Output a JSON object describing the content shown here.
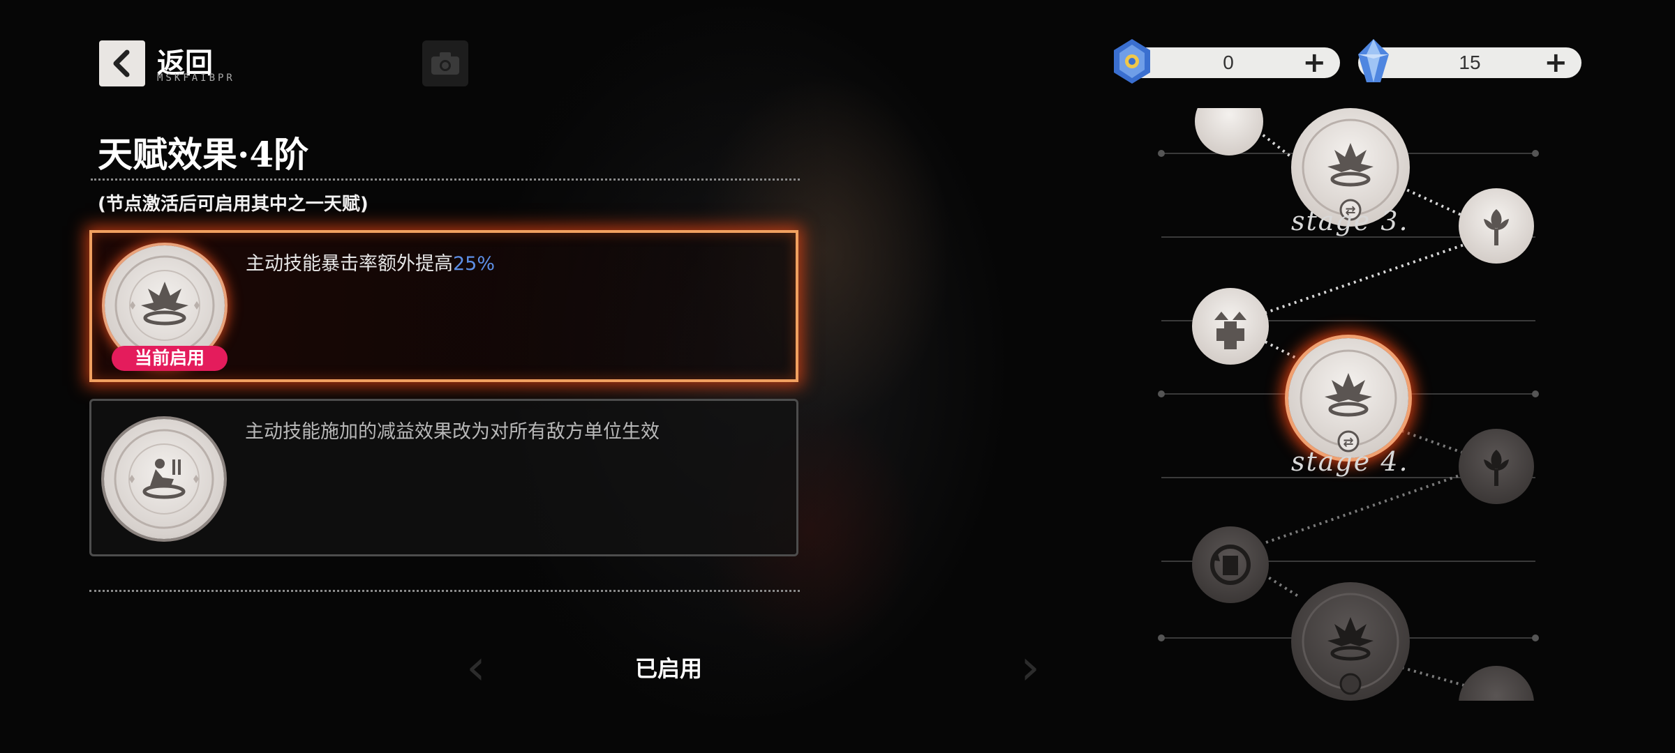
{
  "header": {
    "back_label": "返回",
    "back_subtitle": "MSKFAIBPR"
  },
  "currencies": [
    {
      "icon": "heart-token-icon",
      "value": "0",
      "plus": "+"
    },
    {
      "icon": "crystal-icon",
      "value": "15",
      "plus": "+"
    }
  ],
  "talent": {
    "title": "天赋效果·4阶",
    "note": "(节点激活后可启用其中之一天赋)",
    "options": [
      {
        "desc_prefix": "主动技能暴击率额外提高",
        "desc_highlight": "25%",
        "badge": "当前启用",
        "icon": "burst-medal-icon"
      },
      {
        "desc_prefix": "主动技能施加的减益效果改为对所有敌方单位生效",
        "icon": "kneel-medal-icon"
      }
    ]
  },
  "footer": {
    "status": "已启用"
  },
  "tree": {
    "stages": [
      "stage 3.",
      "stage 4."
    ]
  }
}
